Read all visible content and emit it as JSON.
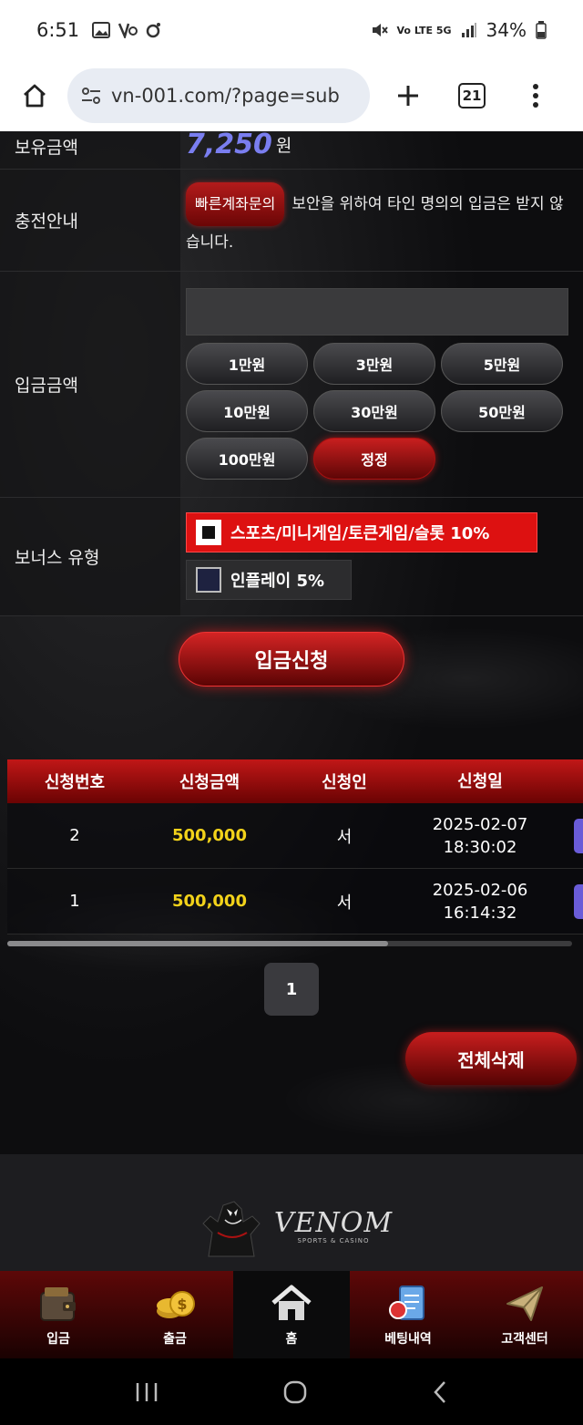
{
  "status_bar": {
    "time": "6:51",
    "left_icons": [
      "image-icon",
      "rec-icon",
      "threads-icon"
    ],
    "signal": "Vo LTE 5G",
    "battery": "34%"
  },
  "browser": {
    "url": "vn-001.com/?page=sub",
    "tab_count": "21"
  },
  "form": {
    "balance_label": "보유금액",
    "balance_value": "7,250",
    "balance_unit": "원",
    "guide_label": "충전안내",
    "guide_badge": "빠른계좌문의",
    "guide_text": "보안을 위하여 타인 명의의 입금은 받지 않습니다.",
    "amount_label": "입금금액",
    "amount_input_value": "",
    "amount_buttons": [
      "1만원",
      "3만원",
      "5만원",
      "10만원",
      "30만원",
      "50만원",
      "100만원",
      "정정"
    ],
    "bonus_label": "보너스 유형",
    "bonus_options": [
      {
        "label": "스포츠/미니게임/토큰게임/슬롯 10%",
        "selected": true
      },
      {
        "label": "인플레이 5%",
        "selected": false
      }
    ],
    "submit_label": "입금신청"
  },
  "history": {
    "columns": [
      "신청번호",
      "신청금액",
      "신청인",
      "신청일"
    ],
    "rows": [
      {
        "no": "2",
        "amount": "500,000",
        "name": "서",
        "date": "2025-02-07",
        "time": "18:30:02"
      },
      {
        "no": "1",
        "amount": "500,000",
        "name": "서",
        "date": "2025-02-06",
        "time": "16:14:32"
      }
    ],
    "page": "1",
    "delete_all_label": "전체삭제"
  },
  "footer": {
    "logo_text": "VENOM",
    "logo_sub": "SPORTS & CASINO"
  },
  "bottom_nav": [
    {
      "label": "입금",
      "icon": "wallet-icon"
    },
    {
      "label": "출금",
      "icon": "coins-icon"
    },
    {
      "label": "홈",
      "icon": "home-icon"
    },
    {
      "label": "베팅내역",
      "icon": "bet-history-icon"
    },
    {
      "label": "고객센터",
      "icon": "paper-plane-icon"
    }
  ],
  "colors": {
    "accent_red": "#c01717",
    "amount_gold": "#f2d21a",
    "balance_purple": "#7a7ef0"
  }
}
